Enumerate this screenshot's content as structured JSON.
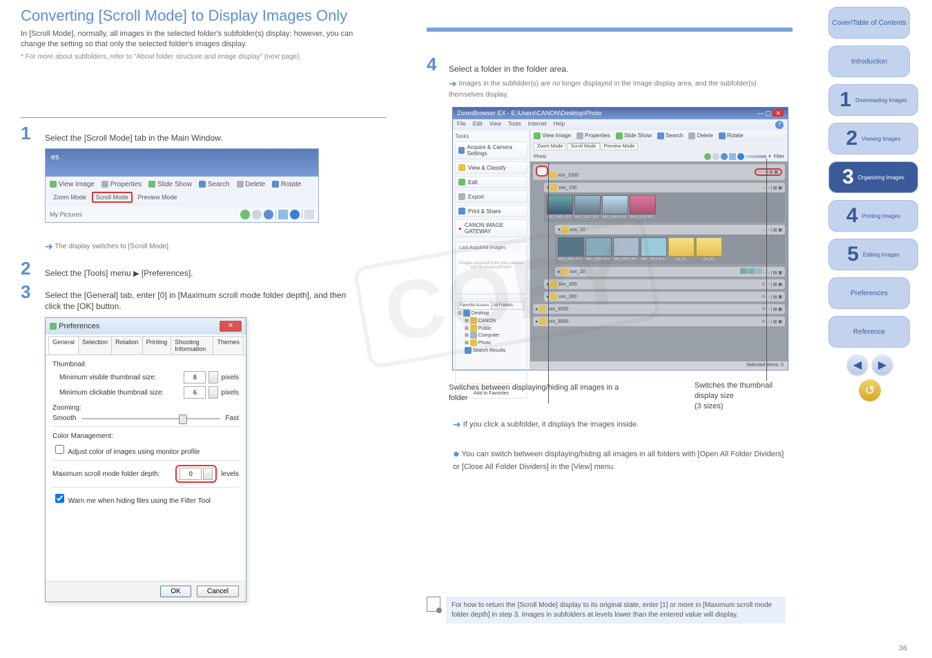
{
  "nav": {
    "cover": "Cover/Table of Contents",
    "intro": "Introduction",
    "tab1_label": "Downloading Images",
    "tab2_label": "Viewing Images",
    "tab3_label": "Organizing Images",
    "tab4_label": "Printing Images",
    "tab5_label": "Editing Images",
    "pref_label": "Preferences",
    "ref_label": "Reference"
  },
  "page_number": "36",
  "header": {
    "title": "Converting [Scroll Mode] to Display Images Only",
    "body": "In [Scroll Mode], normally, all images in the selected folder's subfolder(s) display; however, you can change the setting so that only the selected folder's images display.",
    "note": "* For more about subfolders, refer to \"About folder structure and image display\" (next page)."
  },
  "steps": {
    "s1": {
      "num": "1",
      "text": "Select the [Scroll Mode] tab in the Main Window.",
      "after": "The display switches to [Scroll Mode]."
    },
    "s2": {
      "num": "2",
      "text_a": "Select the [Tools] menu ",
      "text_b": " [Preferences]."
    },
    "s3": {
      "num": "3",
      "body": "Select the [General] tab, enter [0] in [Maximum scroll mode folder depth], and then click the [OK] button."
    },
    "s4": {
      "num": "4",
      "text": "Select a folder in the folder area.",
      "after": "Images in the subfolder(s) are no longer displayed in the Image display area, and the subfolder(s) themselves display."
    }
  },
  "shot1": {
    "titlebar": "es",
    "btns": [
      "View Image",
      "Properties",
      "Slide Show",
      "Search",
      "Delete",
      "Rotate"
    ],
    "modes": [
      "Zoom Mode",
      "Scroll Mode",
      "Preview Mode"
    ],
    "path": "My Pictures"
  },
  "pref": {
    "title": "Preferences",
    "tabs": [
      "General",
      "Selection",
      "Rotation",
      "Printing",
      "Shooting Information",
      "Themes"
    ],
    "thumb_section": "Thumbnail:",
    "min_visible": "Minimum visible thumbnail size:",
    "min_click": "Minimum clickable thumbnail size:",
    "min_visible_val": "8",
    "min_click_val": "6",
    "px": "pixels",
    "zoom_section": "Zooming:",
    "smooth": "Smooth",
    "fast": "Fast",
    "cm_section": "Color Management:",
    "cm_check": "Adjust color of images using monitor profile",
    "depth_label": "Maximum scroll mode folder depth:",
    "depth_val": "0",
    "levels": "levels",
    "warn": "Warn me when hiding files using the Filter Tool",
    "ok": "OK",
    "cancel": "Cancel"
  },
  "app": {
    "title": "ZoomBrowser EX - E:\\Users\\CANON\\Desktop\\Photo",
    "menu": [
      "File",
      "Edit",
      "View",
      "Tools",
      "Internet",
      "Help"
    ],
    "side_tasks": "Tasks",
    "side_btns": [
      "Acquire & Camera Settings",
      "View & Classify",
      "Edit",
      "Export",
      "Print & Share",
      "CANON iMAGE GATEWAY"
    ],
    "lastacq": "Last Acquired Images",
    "lastacq_body": "Images acquired from your camera can be accessed here.",
    "favacc": "Favorite Access",
    "allfolders": "All Folders",
    "tree": [
      "Desktop",
      "CANON",
      "Public",
      "Computer",
      "Photo",
      "Search Results"
    ],
    "addfav": "Add to Favorites",
    "tb2": [
      "View Image",
      "Properties",
      "Slide Show",
      "Search",
      "Delete",
      "Rotate"
    ],
    "modes": [
      "Zoom Mode",
      "Scroll Mode",
      "Preview Mode"
    ],
    "photo_label": "Photo",
    "filter": "Filter",
    "groups": [
      {
        "name": "xxx_1000",
        "thumbs": []
      },
      {
        "name": "xxx_100",
        "thumbs": [
          "IMG_0001.JPG",
          "IMG_0002.JPG",
          "IMG_0005.JPG",
          "IMG_0018.JPG"
        ]
      },
      {
        "name": "xxx_10",
        "thumbs": [
          "IMG_0008.JPG",
          "IMG_0009.JPG",
          "IMG_0012.JPG",
          "IMG_0013.JPG",
          "xxx_01",
          "xxx_02"
        ]
      },
      {
        "name": "xxx_20",
        "thumbs": [
          "t",
          "t",
          "t"
        ]
      },
      {
        "name": "xxx_200",
        "thumbs": []
      },
      {
        "name": "xxx_300",
        "thumbs": []
      },
      {
        "name": "xxx_2000",
        "thumbs": []
      },
      {
        "name": "xxx_3000",
        "thumbs": []
      }
    ],
    "status": "Selected Items: 0"
  },
  "callouts": {
    "c1": "Switches between displaying/hiding all images in a folder",
    "c2_a": "Switches the thumbnail display size",
    "c2_b": "(3 sizes)",
    "arrow_note": "If you click a subfolder, it displays the images inside.",
    "bullet_note": "You can switch between displaying/hiding all images in all folders with [Open All Folder Dividers] or [Close All Folder Dividers] in the [View] menu."
  },
  "footnote": "For how to return the [Scroll Mode] display to its original state, enter [1] or more in [Maximum scroll mode folder depth] in step 3. Images in subfolders at levels lower than the entered value will display.",
  "watermark": "COPY"
}
